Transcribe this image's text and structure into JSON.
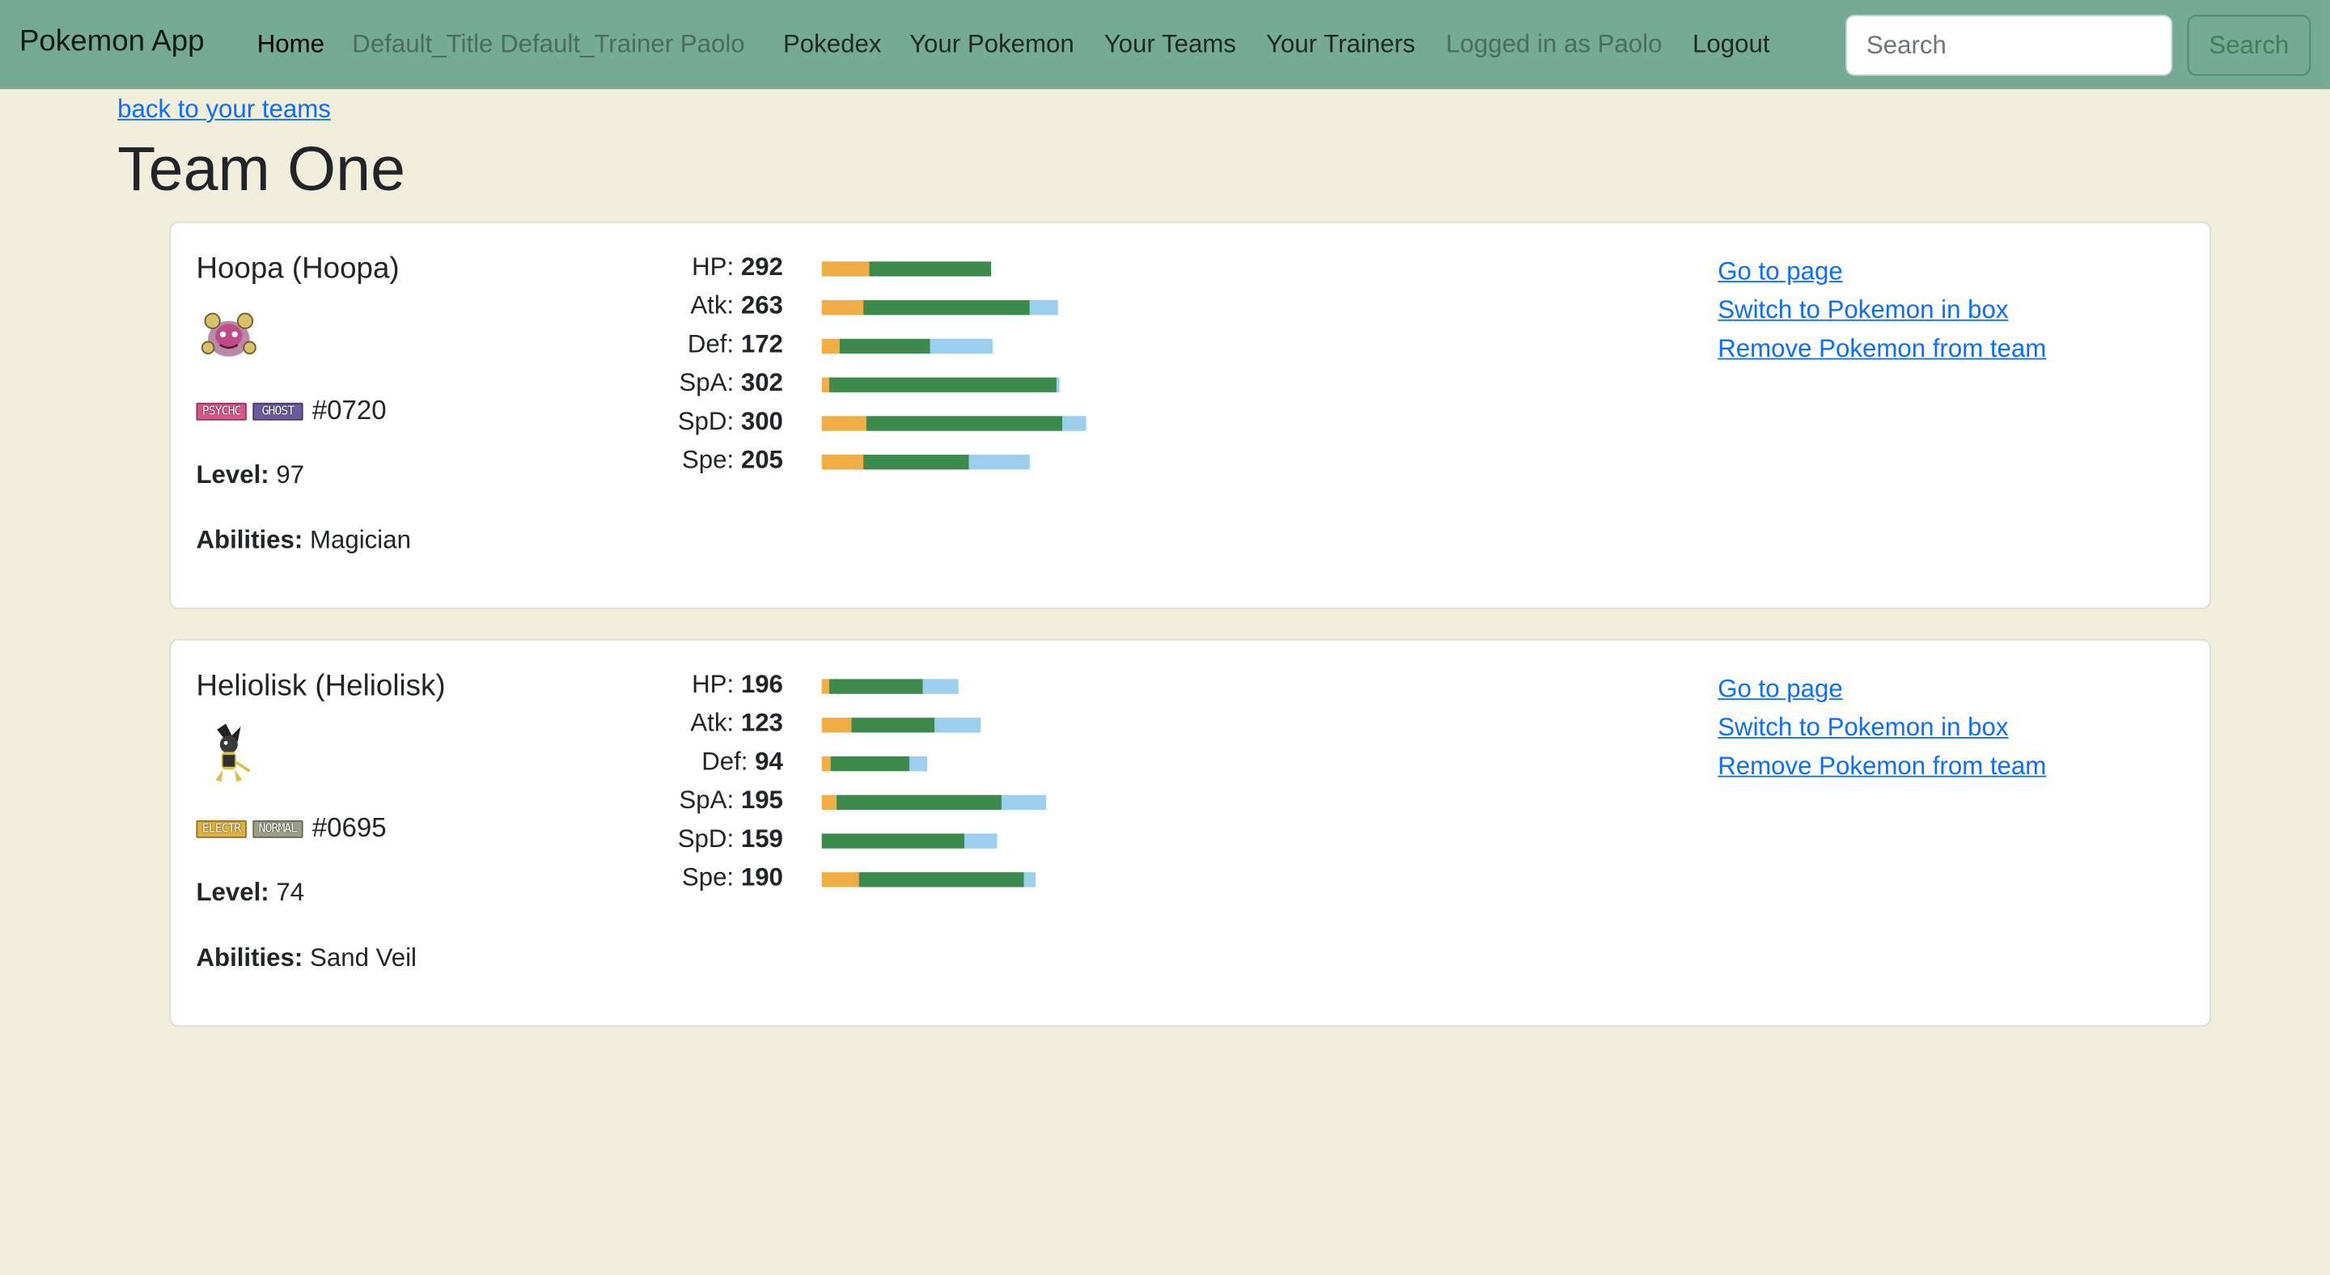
{
  "navbar": {
    "brand": "Pokemon App",
    "items": [
      {
        "label": "Home",
        "style": "active"
      },
      {
        "label": "Default_Title Default_Trainer Paolo",
        "style": "muted"
      },
      {
        "label": "Pokedex",
        "style": "normal"
      },
      {
        "label": "Your Pokemon",
        "style": "normal"
      },
      {
        "label": "Your Teams",
        "style": "normal"
      },
      {
        "label": "Your Trainers",
        "style": "normal"
      },
      {
        "label": "Logged in as Paolo",
        "style": "muted"
      },
      {
        "label": "Logout",
        "style": "normal"
      }
    ],
    "search_placeholder": "Search",
    "search_button": "Search"
  },
  "back_link": "back to your teams",
  "page_title": "Team One",
  "pokemon": [
    {
      "name": "Hoopa (Hoopa)",
      "sprite": "hoopa-sprite",
      "types": [
        {
          "label": "PSYCHC",
          "color": "#d9568a"
        },
        {
          "label": "GHOST",
          "color": "#6b5a9c"
        }
      ],
      "dex": "#0720",
      "level_label": "Level:",
      "level": "97",
      "abilities_label": "Abilities:",
      "abilities": "Magician",
      "stats": [
        {
          "label": "HP:",
          "value": "292",
          "bar": [
            0.32,
            0.82,
            0.0
          ]
        },
        {
          "label": "Atk:",
          "value": "263",
          "bar": [
            0.28,
            1.12,
            0.19
          ]
        },
        {
          "label": "Def:",
          "value": "172",
          "bar": [
            0.12,
            0.61,
            0.42
          ]
        },
        {
          "label": "SpA:",
          "value": "302",
          "bar": [
            0.05,
            1.53,
            0.02
          ]
        },
        {
          "label": "SpD:",
          "value": "300",
          "bar": [
            0.3,
            1.32,
            0.16
          ]
        },
        {
          "label": "Spe:",
          "value": "205",
          "bar": [
            0.28,
            0.71,
            0.41
          ]
        }
      ],
      "actions": [
        "Go to page",
        "Switch to Pokemon in box",
        "Remove Pokemon from team"
      ]
    },
    {
      "name": "Heliolisk (Heliolisk)",
      "sprite": "heliolisk-sprite",
      "types": [
        {
          "label": "ELECTR",
          "color": "#e0b13c"
        },
        {
          "label": "NORMAL",
          "color": "#9e9e86"
        }
      ],
      "dex": "#0695",
      "level_label": "Level:",
      "level": "74",
      "abilities_label": "Abilities:",
      "abilities": "Sand Veil",
      "stats": [
        {
          "label": "HP:",
          "value": "196",
          "bar": [
            0.05,
            0.63,
            0.24
          ]
        },
        {
          "label": "Atk:",
          "value": "123",
          "bar": [
            0.2,
            0.56,
            0.31
          ]
        },
        {
          "label": "Def:",
          "value": "94",
          "bar": [
            0.06,
            0.53,
            0.12
          ]
        },
        {
          "label": "SpA:",
          "value": "195",
          "bar": [
            0.1,
            1.11,
            0.3
          ]
        },
        {
          "label": "SpD:",
          "value": "159",
          "bar": [
            0.0,
            0.96,
            0.22
          ]
        },
        {
          "label": "Spe:",
          "value": "190",
          "bar": [
            0.25,
            1.11,
            0.08
          ]
        }
      ],
      "actions": [
        "Go to page",
        "Switch to Pokemon in box",
        "Remove Pokemon from team"
      ]
    }
  ]
}
